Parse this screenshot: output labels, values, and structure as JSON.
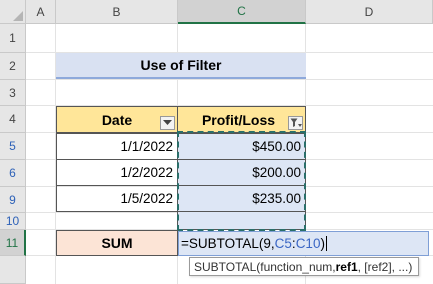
{
  "columns": [
    "A",
    "B",
    "C",
    "D"
  ],
  "rows": [
    "1",
    "2",
    "3",
    "4",
    "5",
    "6",
    "9",
    "10",
    "11"
  ],
  "title": "Use of Filter",
  "table": {
    "headers": [
      "Date",
      "Profit/Loss"
    ],
    "rows": [
      {
        "row": "5",
        "date": "1/1/2022",
        "profit": "$450.00"
      },
      {
        "row": "6",
        "date": "1/2/2022",
        "profit": "$200.00"
      },
      {
        "row": "9",
        "date": "1/5/2022",
        "profit": "$235.00"
      }
    ]
  },
  "sum_label": "SUM",
  "formula": {
    "prefix": "=SUBTOTAL(9,",
    "ref_start": "C5",
    "sep": ":",
    "ref_end": "C10",
    "suffix": ")"
  },
  "tooltip": {
    "func": "SUBTOTAL(function_num, ",
    "bold_arg": "ref1",
    "rest": ", [ref2], ...)"
  },
  "icons": {
    "filter": "filter-dropdown-icon",
    "filter_active": "filter-active-icon"
  },
  "colors": {
    "title_bg": "#d9e1f2",
    "header_bg": "#ffe699",
    "sum_bg": "#fce4d6",
    "selected_bg": "#dde6f5",
    "row_number_filtered": "#2e62b8"
  }
}
